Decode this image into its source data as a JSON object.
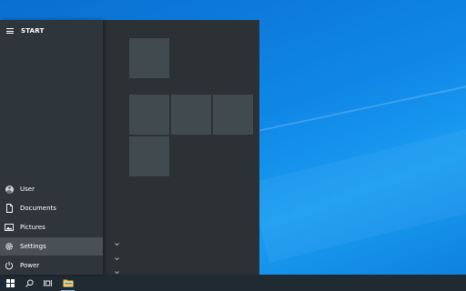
{
  "start_menu": {
    "title": "START",
    "rail_items": [
      {
        "label": "User",
        "icon": "user-avatar-icon"
      },
      {
        "label": "Documents",
        "icon": "document-icon"
      },
      {
        "label": "Pictures",
        "icon": "pictures-icon"
      },
      {
        "label": "Settings",
        "icon": "gear-icon",
        "active": true
      },
      {
        "label": "Power",
        "icon": "power-icon"
      }
    ]
  },
  "taskbar": {
    "buttons": [
      "windows-start-icon",
      "search-icon",
      "task-view-icon",
      "file-explorer-icon"
    ]
  },
  "colors": {
    "menu_bg": "#2b3135",
    "rail_bg": "#2f363b",
    "tile_bg": "#414a4f",
    "taskbar_bg": "#1f2a33",
    "accent_blue": "#0f86e6"
  }
}
